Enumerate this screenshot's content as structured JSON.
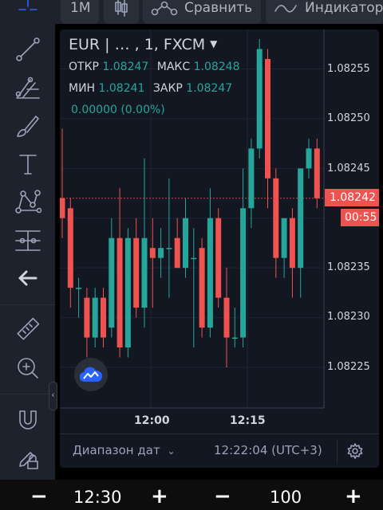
{
  "toolbar": {
    "timeframe": "1M",
    "compare_label": "Сравнить",
    "indicators_label": "Индикаторы"
  },
  "sidebar": {
    "tools": [
      "crosshair-icon",
      "trend-line-icon",
      "fib-retracement-icon",
      "brush-icon",
      "text-icon",
      "pattern-icon",
      "measure-icon",
      "back-arrow-icon",
      "ruler-icon",
      "zoom-in-icon",
      "magnet-icon",
      "lock-icon"
    ]
  },
  "legend": {
    "symbol": "EUR | …  , 1, FXCM",
    "open_label": "ОТКР",
    "open": "1.08247",
    "high_label": "МАКС",
    "high": "1.08248",
    "low_label": "МИН",
    "low": "1.08241",
    "close_label": "ЗАКР",
    "close": "1.08247",
    "change": "0.00000 (0.00%)"
  },
  "price_axis": {
    "labels": [
      "1.08255",
      "1.08250",
      "1.08245",
      "1.08240",
      "1.08235",
      "1.08230",
      "1.08225"
    ],
    "current_price": "1.08242",
    "countdown": "00:55"
  },
  "time_axis": {
    "labels": [
      "12:00",
      "12:15"
    ]
  },
  "bottom_bar": {
    "date_range_label": "Диапазон дат",
    "clock": "12:22:04 (UTC+3)"
  },
  "bottom_strip": {
    "minus_left": "−",
    "time_value": "12:30",
    "plus_left": "+",
    "minus_right": "−",
    "amount_value": "100",
    "plus_right": "+"
  },
  "colors": {
    "up": "#26a69a",
    "down": "#ef5350",
    "background": "#131722",
    "panel": "#1e222d"
  },
  "chart_data": {
    "type": "candlestick",
    "title": "EUR | …  , 1, FXCM",
    "x_range": [
      "11:52",
      "12:20"
    ],
    "ylim": [
      1.08224,
      1.08258
    ],
    "y_ticks": [
      1.08225,
      1.0823,
      1.08235,
      1.0824,
      1.08245,
      1.0825,
      1.08255
    ],
    "x_ticks": [
      "12:00",
      "12:15"
    ],
    "current_price": 1.08242,
    "candles": [
      {
        "t": "11:52",
        "o": 1.08242,
        "h": 1.08249,
        "l": 1.08238,
        "c": 1.0824
      },
      {
        "t": "11:53",
        "o": 1.08241,
        "h": 1.08242,
        "l": 1.08231,
        "c": 1.08233
      },
      {
        "t": "11:54",
        "o": 1.08233,
        "h": 1.08234,
        "l": 1.0823,
        "c": 1.08233
      },
      {
        "t": "11:55",
        "o": 1.08232,
        "h": 1.08233,
        "l": 1.08226,
        "c": 1.08228
      },
      {
        "t": "11:56",
        "o": 1.08228,
        "h": 1.08233,
        "l": 1.08227,
        "c": 1.08232
      },
      {
        "t": "11:57",
        "o": 1.08232,
        "h": 1.08233,
        "l": 1.08227,
        "c": 1.08228
      },
      {
        "t": "11:58",
        "o": 1.08229,
        "h": 1.0824,
        "l": 1.08228,
        "c": 1.08238
      },
      {
        "t": "11:59",
        "o": 1.08238,
        "h": 1.08243,
        "l": 1.08226,
        "c": 1.08227
      },
      {
        "t": "12:00",
        "o": 1.08227,
        "h": 1.08239,
        "l": 1.08226,
        "c": 1.08238
      },
      {
        "t": "12:01",
        "o": 1.08238,
        "h": 1.0824,
        "l": 1.0823,
        "c": 1.08231
      },
      {
        "t": "12:02",
        "o": 1.08231,
        "h": 1.08246,
        "l": 1.08229,
        "c": 1.08238
      },
      {
        "t": "12:03",
        "o": 1.08237,
        "h": 1.0824,
        "l": 1.08231,
        "c": 1.08236
      },
      {
        "t": "12:04",
        "o": 1.08236,
        "h": 1.08239,
        "l": 1.08234,
        "c": 1.08237
      },
      {
        "t": "12:05",
        "o": 1.08237,
        "h": 1.08244,
        "l": 1.08232,
        "c": 1.08237
      },
      {
        "t": "12:06",
        "o": 1.08238,
        "h": 1.0824,
        "l": 1.08235,
        "c": 1.08235
      },
      {
        "t": "12:07",
        "o": 1.08235,
        "h": 1.08242,
        "l": 1.08234,
        "c": 1.0824
      },
      {
        "t": "12:08",
        "o": 1.08236,
        "h": 1.08239,
        "l": 1.08227,
        "c": 1.08236
      },
      {
        "t": "12:09",
        "o": 1.08237,
        "h": 1.08238,
        "l": 1.08228,
        "c": 1.08229
      },
      {
        "t": "12:10",
        "o": 1.08229,
        "h": 1.08243,
        "l": 1.08228,
        "c": 1.0824
      },
      {
        "t": "12:11",
        "o": 1.0824,
        "h": 1.08241,
        "l": 1.08231,
        "c": 1.08232
      },
      {
        "t": "12:12",
        "o": 1.08232,
        "h": 1.08235,
        "l": 1.08225,
        "c": 1.08228
      },
      {
        "t": "12:13",
        "o": 1.08228,
        "h": 1.08231,
        "l": 1.08227,
        "c": 1.08228
      },
      {
        "t": "12:14",
        "o": 1.08228,
        "h": 1.08245,
        "l": 1.08227,
        "c": 1.08241
      },
      {
        "t": "12:15",
        "o": 1.08241,
        "h": 1.08248,
        "l": 1.08239,
        "c": 1.08247
      },
      {
        "t": "12:16",
        "o": 1.08247,
        "h": 1.08258,
        "l": 1.08246,
        "c": 1.08257
      },
      {
        "t": "12:17",
        "o": 1.08256,
        "h": 1.08257,
        "l": 1.08241,
        "c": 1.08244
      },
      {
        "t": "12:18",
        "o": 1.08244,
        "h": 1.08245,
        "l": 1.08234,
        "c": 1.08236
      },
      {
        "t": "12:19",
        "o": 1.08236,
        "h": 1.08239,
        "l": 1.08234,
        "c": 1.0824
      },
      {
        "t": "12:20",
        "o": 1.0824,
        "h": 1.08241,
        "l": 1.08232,
        "c": 1.08235
      },
      {
        "t": "12:21",
        "o": 1.08235,
        "h": 1.08242,
        "l": 1.08232,
        "c": 1.08245
      },
      {
        "t": "12:22",
        "o": 1.08245,
        "h": 1.08248,
        "l": 1.08244,
        "c": 1.08247
      },
      {
        "t": "12:23",
        "o": 1.08247,
        "h": 1.08248,
        "l": 1.08241,
        "c": 1.08242
      }
    ]
  }
}
